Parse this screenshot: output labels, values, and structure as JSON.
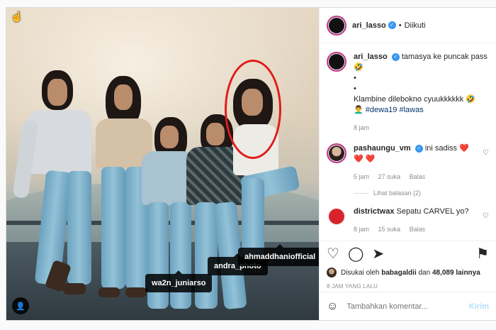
{
  "post": {
    "tags": [
      "wa2n_juniarso",
      "andra_photo",
      "ahmaddhaniofficial"
    ],
    "highlight_color": "#e21b1b"
  },
  "header": {
    "username": "ari_lasso",
    "follow_status": "Diikuti"
  },
  "comments": [
    {
      "username": "ari_lasso",
      "text_1": "tamasya ke puncak pass",
      "emoji_1": "🤣",
      "dot_1": "•",
      "dot_2": "•",
      "text_2": "Klambine dilebokno cyuukkkkkk",
      "emoji_2": "🤣",
      "text_3_icon": "👨‍🦱",
      "hashtags": "#dewa19 #lawas",
      "time": "8 jam"
    },
    {
      "username": "pashaungu_vm",
      "text": "ini sadiss",
      "hearts": "❤️❤️ ❤️",
      "time": "5 jam",
      "likes": "27 suka",
      "reply": "Balas",
      "view_replies": "Lihat balasan (2)"
    },
    {
      "username": "districtwax",
      "text": "Sepatu CARVEL yo?",
      "time": "8 jam",
      "likes": "15 suka",
      "reply": "Balas"
    }
  ],
  "likes": {
    "prefix": "Disukai oleh",
    "user": "babagaldii",
    "middle": "dan",
    "count": "48,089 lainnya"
  },
  "time_ago": "8 JAM YANG LALU",
  "composer": {
    "placeholder": "Tambahkan komentar...",
    "send_label": "Kirim"
  }
}
